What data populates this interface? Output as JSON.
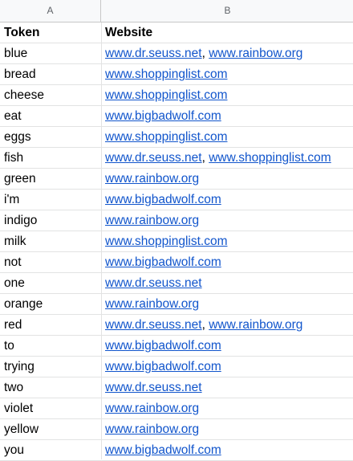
{
  "columns": {
    "a": "A",
    "b": "B"
  },
  "headers": {
    "token": "Token",
    "website": "Website"
  },
  "rows": [
    {
      "token": "blue",
      "links": [
        "www.dr.seuss.net",
        "www.rainbow.org"
      ]
    },
    {
      "token": "bread",
      "links": [
        "www.shoppinglist.com"
      ]
    },
    {
      "token": "cheese",
      "links": [
        "www.shoppinglist.com"
      ]
    },
    {
      "token": "eat",
      "links": [
        "www.bigbadwolf.com"
      ]
    },
    {
      "token": "eggs",
      "links": [
        "www.shoppinglist.com"
      ]
    },
    {
      "token": "fish",
      "links": [
        "www.dr.seuss.net",
        "www.shoppinglist.com"
      ]
    },
    {
      "token": "green",
      "links": [
        "www.rainbow.org"
      ]
    },
    {
      "token": "i'm",
      "links": [
        "www.bigbadwolf.com"
      ]
    },
    {
      "token": "indigo",
      "links": [
        "www.rainbow.org"
      ]
    },
    {
      "token": "milk",
      "links": [
        "www.shoppinglist.com"
      ]
    },
    {
      "token": "not",
      "links": [
        "www.bigbadwolf.com"
      ]
    },
    {
      "token": "one",
      "links": [
        "www.dr.seuss.net"
      ]
    },
    {
      "token": "orange",
      "links": [
        "www.rainbow.org"
      ]
    },
    {
      "token": "red",
      "links": [
        "www.dr.seuss.net",
        "www.rainbow.org"
      ]
    },
    {
      "token": "to",
      "links": [
        "www.bigbadwolf.com"
      ]
    },
    {
      "token": "trying",
      "links": [
        "www.bigbadwolf.com"
      ]
    },
    {
      "token": "two",
      "links": [
        "www.dr.seuss.net"
      ]
    },
    {
      "token": "violet",
      "links": [
        "www.rainbow.org"
      ]
    },
    {
      "token": "yellow",
      "links": [
        "www.rainbow.org"
      ]
    },
    {
      "token": "you",
      "links": [
        "www.bigbadwolf.com"
      ]
    }
  ],
  "link_separator": ", ",
  "colors": {
    "link": "#1155cc",
    "header_bg": "#f8f9fa",
    "gridline": "#e2e3e3"
  }
}
